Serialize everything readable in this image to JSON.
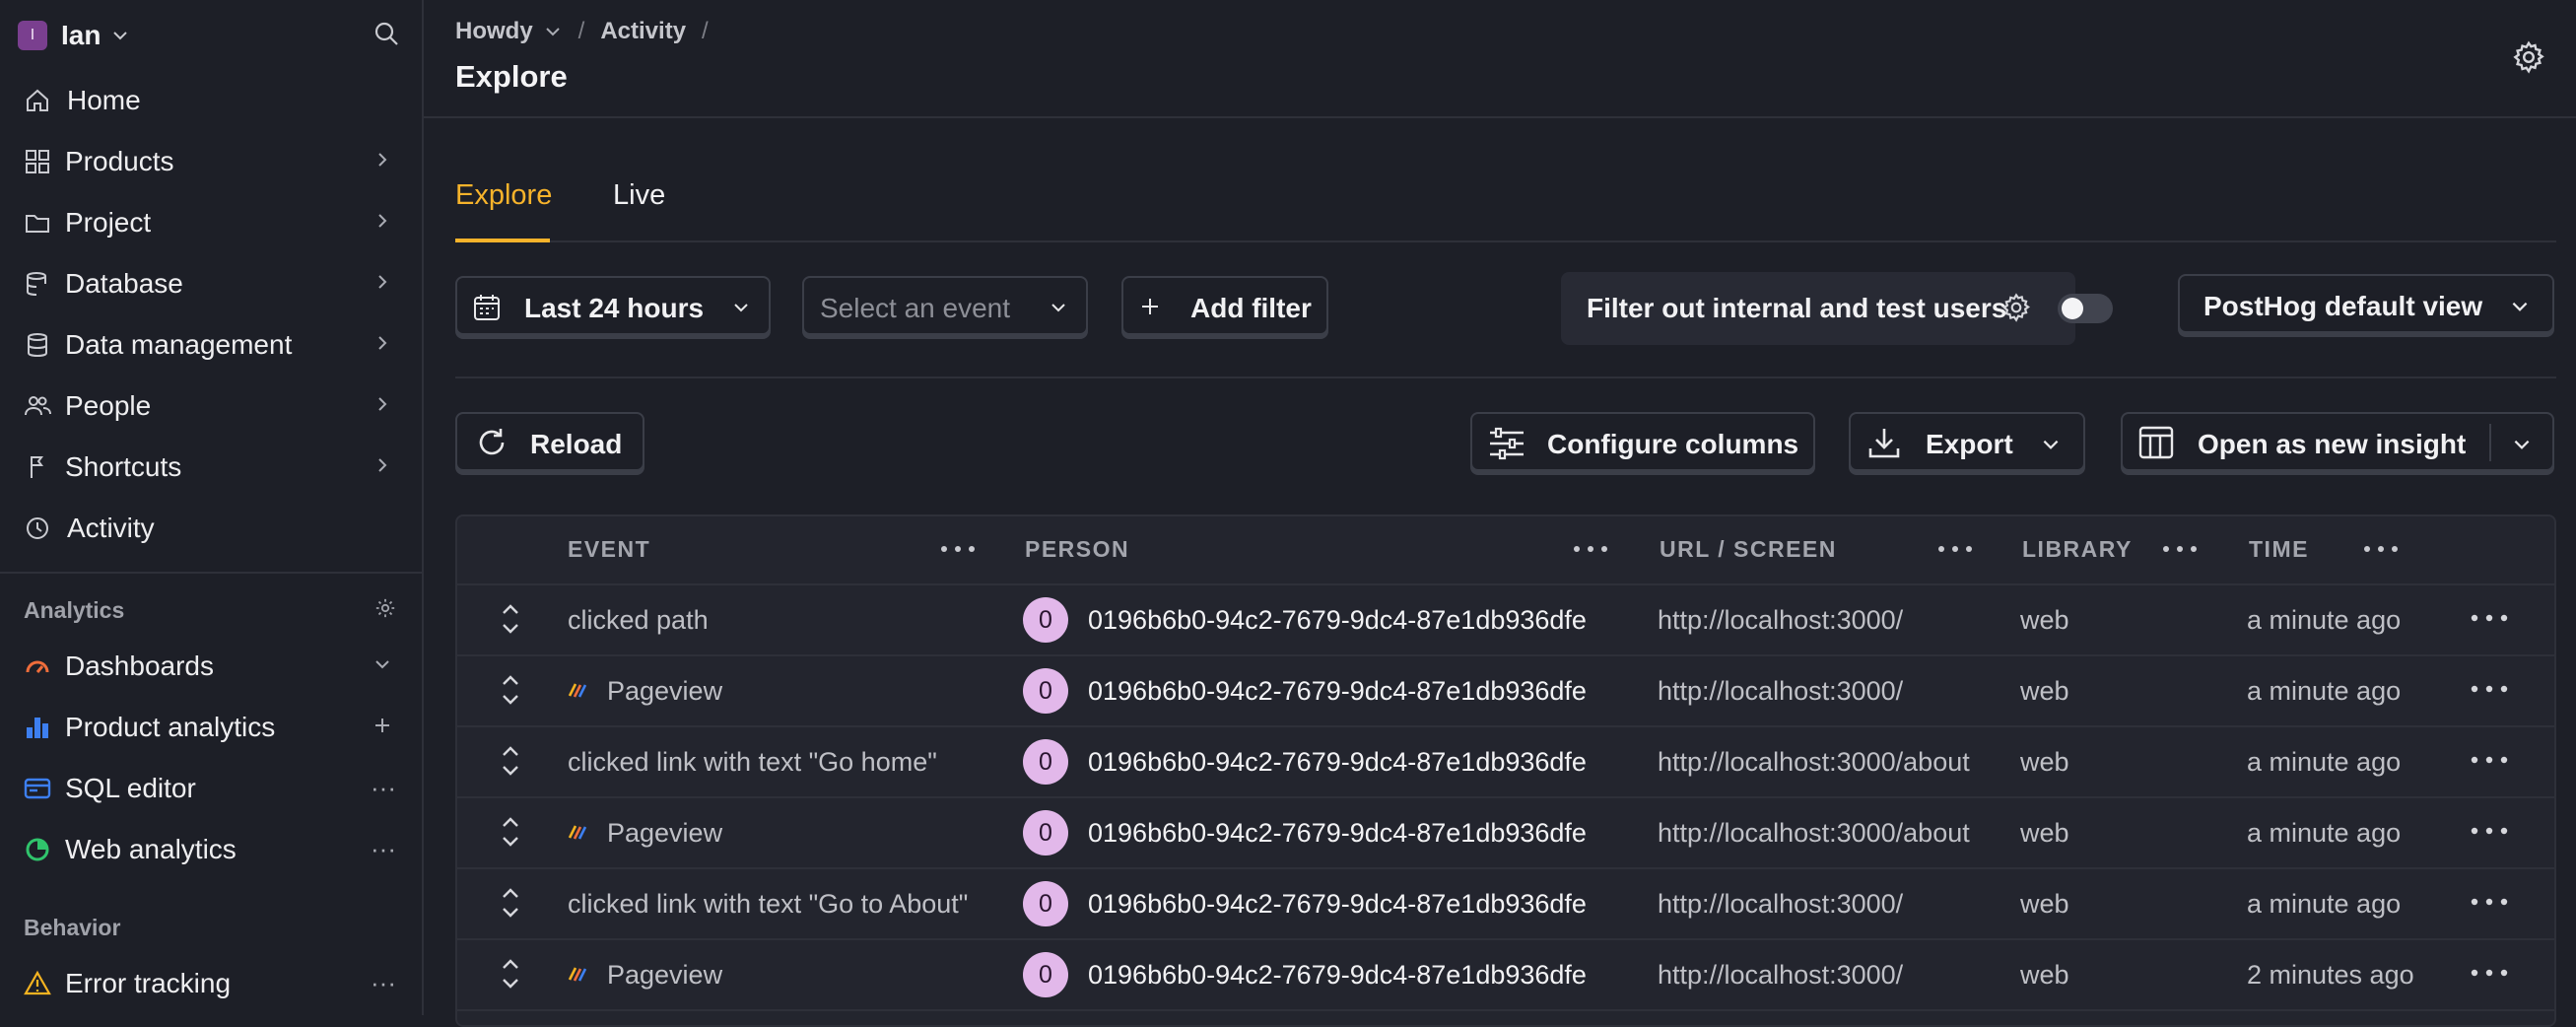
{
  "sidebar": {
    "org_initial": "I",
    "org_name": "Ian",
    "items": [
      {
        "label": "Home",
        "icon": "home-icon"
      },
      {
        "label": "Products",
        "icon": "grid-icon"
      },
      {
        "label": "Project",
        "icon": "folder-icon"
      },
      {
        "label": "Database",
        "icon": "database-icon"
      },
      {
        "label": "Data management",
        "icon": "data-management-icon"
      },
      {
        "label": "People",
        "icon": "people-icon"
      },
      {
        "label": "Shortcuts",
        "icon": "shortcut-icon"
      },
      {
        "label": "Activity",
        "icon": "clock-icon"
      }
    ],
    "analytics_section": "Analytics",
    "analytics_items": [
      {
        "label": "Dashboards",
        "icon": "dashboard-icon"
      },
      {
        "label": "Product analytics",
        "icon": "bar-chart-icon"
      },
      {
        "label": "SQL editor",
        "icon": "sql-editor-icon"
      },
      {
        "label": "Web analytics",
        "icon": "web-analytics-icon"
      }
    ],
    "behavior_section": "Behavior",
    "behavior_items": [
      {
        "label": "Error tracking",
        "icon": "warning-icon"
      }
    ]
  },
  "header": {
    "breadcrumbs": [
      "Howdy",
      "Activity"
    ],
    "title": "Explore"
  },
  "tabs": [
    "Explore",
    "Live"
  ],
  "toolbar": {
    "date_range": "Last 24 hours",
    "event_placeholder": "Select an event",
    "add_filter": "Add filter",
    "filter_internal": "Filter out internal and test users",
    "filter_internal_enabled": false,
    "view": "PostHog default view",
    "reload": "Reload",
    "configure_columns": "Configure columns",
    "export": "Export",
    "open_insight": "Open as new insight"
  },
  "table": {
    "columns": [
      "EVENT",
      "PERSON",
      "URL / SCREEN",
      "LIBRARY",
      "TIME"
    ],
    "rows": [
      {
        "event": "clicked path",
        "pageview": false,
        "person_initial": "0",
        "person": "0196b6b0-94c2-7679-9dc4-87e1db936dfe",
        "url": "http://localhost:3000/",
        "library": "web",
        "time": "a minute ago"
      },
      {
        "event": "Pageview",
        "pageview": true,
        "person_initial": "0",
        "person": "0196b6b0-94c2-7679-9dc4-87e1db936dfe",
        "url": "http://localhost:3000/",
        "library": "web",
        "time": "a minute ago"
      },
      {
        "event": "clicked link with text \"Go home\"",
        "pageview": false,
        "person_initial": "0",
        "person": "0196b6b0-94c2-7679-9dc4-87e1db936dfe",
        "url": "http://localhost:3000/about",
        "library": "web",
        "time": "a minute ago"
      },
      {
        "event": "Pageview",
        "pageview": true,
        "person_initial": "0",
        "person": "0196b6b0-94c2-7679-9dc4-87e1db936dfe",
        "url": "http://localhost:3000/about",
        "library": "web",
        "time": "a minute ago"
      },
      {
        "event": "clicked link with text \"Go to About\"",
        "pageview": false,
        "person_initial": "0",
        "person": "0196b6b0-94c2-7679-9dc4-87e1db936dfe",
        "url": "http://localhost:3000/",
        "library": "web",
        "time": "a minute ago"
      },
      {
        "event": "Pageview",
        "pageview": true,
        "person_initial": "0",
        "person": "0196b6b0-94c2-7679-9dc4-87e1db936dfe",
        "url": "http://localhost:3000/",
        "library": "web",
        "time": "2 minutes ago"
      }
    ]
  },
  "colors": {
    "accent": "#f7b32b",
    "background": "#1d1f27",
    "avatar": "#e2b8ea"
  }
}
